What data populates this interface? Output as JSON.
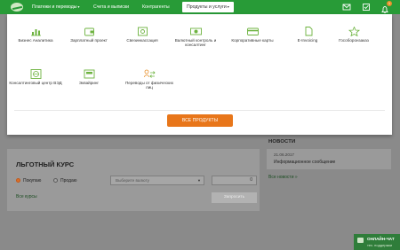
{
  "nav": {
    "items": [
      {
        "label": "Платежи и переводы",
        "has_caret": true
      },
      {
        "label": "Счета и выписки",
        "has_caret": false
      },
      {
        "label": "Контрагенты",
        "has_caret": false
      },
      {
        "label": "Продукты и услуги",
        "has_caret": true,
        "active": true
      }
    ],
    "caret": "▾",
    "notifications_count": "1",
    "icons": [
      "mail-icon",
      "tasks-icon",
      "bell-icon"
    ]
  },
  "products": {
    "row1": [
      {
        "label": "Бизнес Аналитика",
        "icon": "analytics-icon"
      },
      {
        "label": "Зарплатный проект",
        "icon": "wallet-icon"
      },
      {
        "label": "Свеэинкассация",
        "icon": "safe-icon"
      },
      {
        "label": "Валютный контроль и консалтинг",
        "icon": "currency-icon"
      },
      {
        "label": "Корпоративные карты",
        "icon": "card-icon"
      },
      {
        "label": "E-Invoicing",
        "icon": "invoice-icon"
      },
      {
        "label": "Гособоронзаказ",
        "icon": "star-icon"
      }
    ],
    "row2": [
      {
        "label": "Консалтинговый центр ВЭД",
        "icon": "globe-icon"
      },
      {
        "label": "Эквайринг",
        "icon": "terminal-icon"
      },
      {
        "label": "Переводы от физических лиц",
        "icon": "transfer-icon"
      }
    ],
    "all_button": "ВСЕ ПРОДУКТЫ"
  },
  "rate": {
    "title": "ЛЬГОТНЫЙ КУРС",
    "buy": "Покупаю",
    "sell": "Продаю",
    "currency_placeholder": "Выберите валюту",
    "amount": "0",
    "request_button": "Запросить",
    "all_courses": "Все курсы"
  },
  "news": {
    "title": "НОВОСТИ",
    "date": "21.06.2017",
    "text": "Информационное сообщение",
    "all_link": "Все новости »"
  },
  "chat": {
    "title": "ОНЛАЙН-ЧАТ",
    "subtitle": "тех. поддержки"
  },
  "colors": {
    "brand_green": "#289b37",
    "accent_orange": "#e8761a",
    "icon_green": "#6db33f"
  }
}
